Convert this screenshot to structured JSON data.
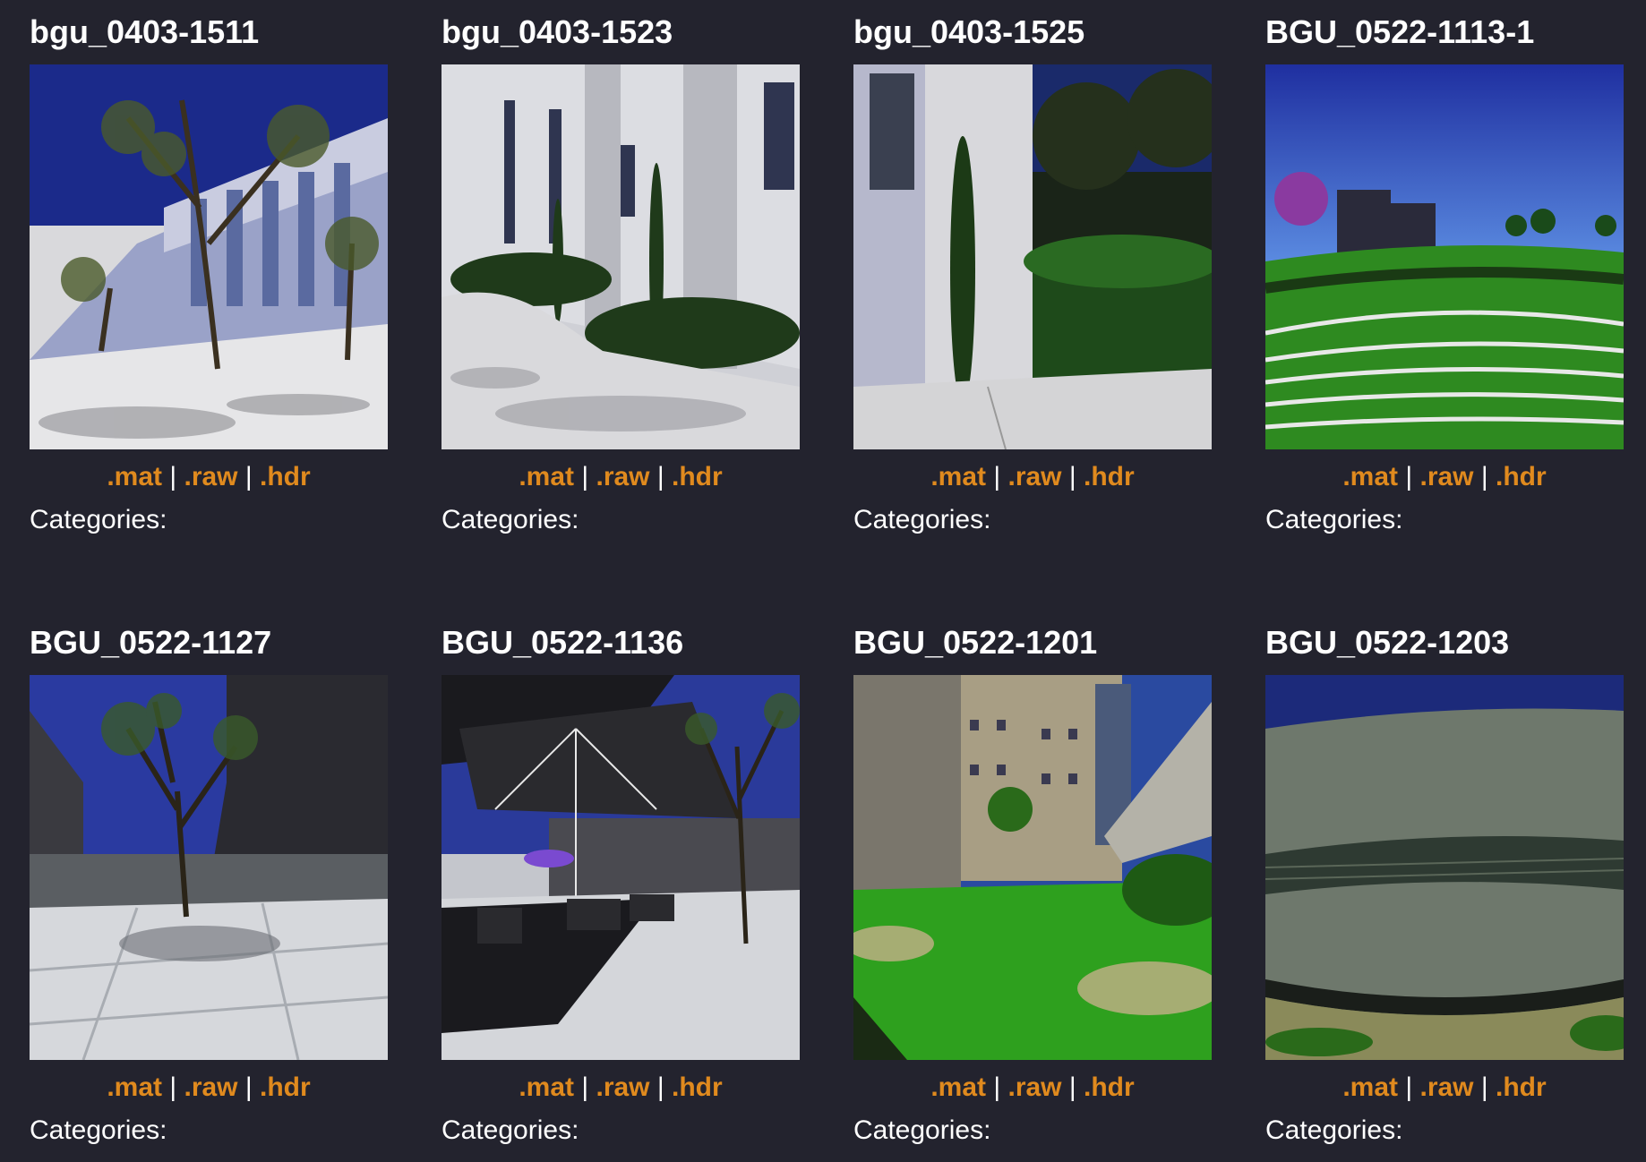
{
  "links": {
    "mat": ".mat",
    "raw": ".raw",
    "hdr": ".hdr",
    "separator": "|"
  },
  "categories_label": "Categories:",
  "items": [
    {
      "title": "bgu_0403-1511",
      "scene": "building-trees-plaza"
    },
    {
      "title": "bgu_0403-1523",
      "scene": "building-cypress-walkway"
    },
    {
      "title": "bgu_0403-1525",
      "scene": "pillar-cypress-hedge"
    },
    {
      "title": "BGU_0522-1113-1",
      "scene": "terraced-lawn"
    },
    {
      "title": "BGU_0522-1127",
      "scene": "courtyard-tree"
    },
    {
      "title": "BGU_0522-1136",
      "scene": "cafe-umbrella-patio"
    },
    {
      "title": "BGU_0522-1201",
      "scene": "lawn-between-buildings"
    },
    {
      "title": "BGU_0522-1203",
      "scene": "concrete-wall"
    }
  ]
}
